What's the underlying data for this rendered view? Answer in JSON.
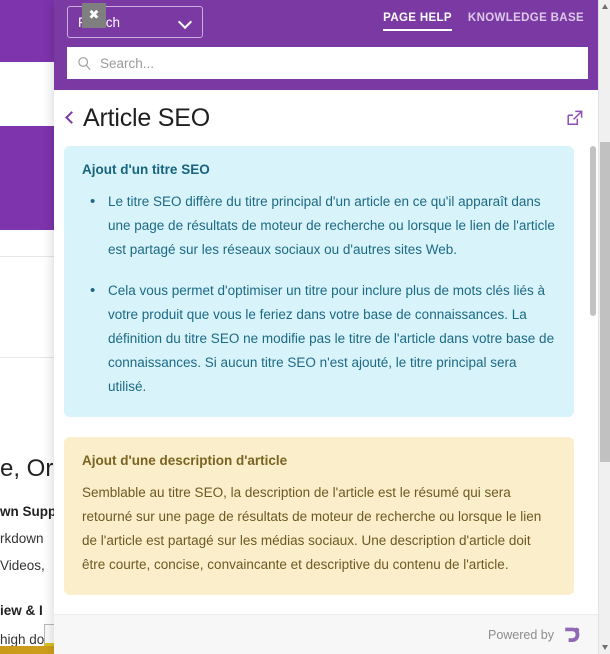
{
  "widget": {
    "header": {
      "close_label": "✖",
      "language_value": "French",
      "language_icon": "chevron-down-icon",
      "tabs": [
        {
          "label": "PAGE HELP",
          "active": true
        },
        {
          "label": "KNOWLEDGE BASE",
          "active": false
        }
      ],
      "search": {
        "placeholder": "Search...",
        "value": "",
        "icon": "search-icon"
      }
    },
    "article": {
      "back_icon": "chevron-left-icon",
      "title": "Article SEO",
      "popout_icon": "external-link-icon",
      "cards": [
        {
          "style": "cyan",
          "title": "Ajout d'un titre SEO",
          "bullets": [
            "Le titre SEO diffère du titre principal d'un article en ce qu'il apparaît dans une page de résultats de moteur de recherche ou lorsque le lien de l'article est partagé sur les réseaux sociaux ou d'autres sites Web.",
            "Cela vous permet d'optimiser un titre pour inclure plus de mots clés liés à votre produit que vous le feriez dans votre base de connaissances. La définition du titre SEO ne modifie pas le titre de l'article dans votre base de connaissances. Si aucun titre SEO n'est ajouté, le titre principal sera utilisé."
          ]
        },
        {
          "style": "cream",
          "title": "Ajout d'une description d'article",
          "paragraph": "Semblable au titre SEO, la description de l'article est le résumé qui sera retourné sur une page de résultats de moteur de recherche ou lorsque le lien de l'article est partagé sur les médias sociaux. Une description d'article doit être courte, concise, convaincante et descriptive du contenu de l'article."
        }
      ]
    },
    "footer": {
      "powered_by_label": "Powered by",
      "logo_icon": "brand-logo-icon"
    }
  },
  "background_page": {
    "heading": "e, Org",
    "section_1_title": "wn Supp",
    "section_1_line_1": "rkdown",
    "section_1_line_2": "Videos,",
    "section_2_title": "iew & I",
    "section_2_line_1": "high doc"
  },
  "colors": {
    "brand_purple": "#7b3aa3",
    "bg_purple": "#7d34ad",
    "card_cyan_bg": "#d9f3fb",
    "card_cyan_text": "#1b6a84",
    "card_cream_bg": "#faeecb",
    "card_cream_text": "#6d5a23",
    "gold_bar": "#c99a18"
  }
}
